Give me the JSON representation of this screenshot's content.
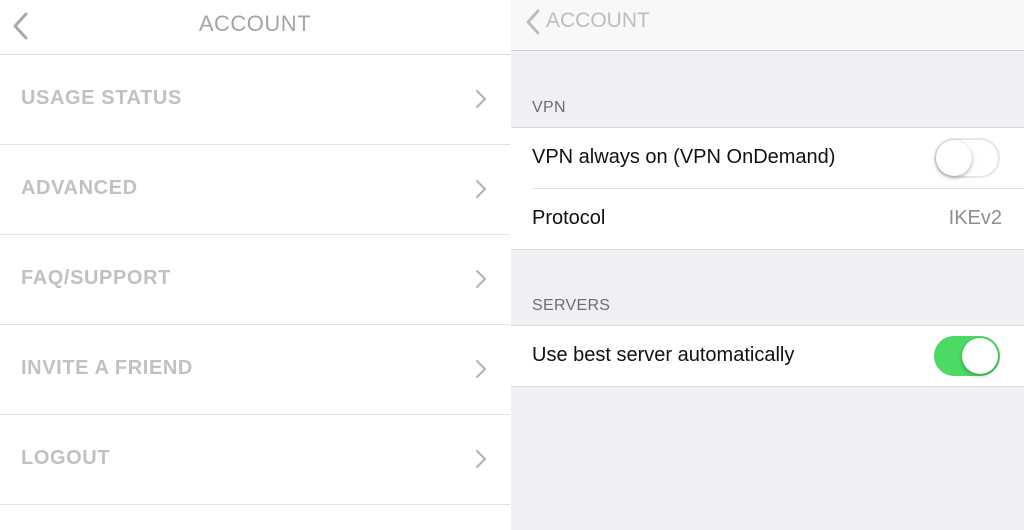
{
  "left_panel": {
    "title": "ACCOUNT",
    "menu": [
      {
        "label": "USAGE STATUS"
      },
      {
        "label": "ADVANCED"
      },
      {
        "label": "FAQ/SUPPORT"
      },
      {
        "label": "INVITE A FRIEND"
      },
      {
        "label": "LOGOUT"
      }
    ]
  },
  "right_panel": {
    "back_label": "ACCOUNT",
    "vpn_section": {
      "header": "VPN",
      "always_on_label": "VPN always on (VPN OnDemand)",
      "always_on_state": "off",
      "protocol_label": "Protocol",
      "protocol_value": "IKEv2"
    },
    "servers_section": {
      "header": "SERVERS",
      "best_server_label": "Use best server automatically",
      "best_server_state": "on"
    }
  },
  "colors": {
    "toggle_on": "#4cd964",
    "menu_text": "#c1c1c1",
    "grouped_background": "#efeff4"
  },
  "icons": {
    "back": "chevron-left-icon",
    "disclosure": "chevron-right-icon"
  }
}
